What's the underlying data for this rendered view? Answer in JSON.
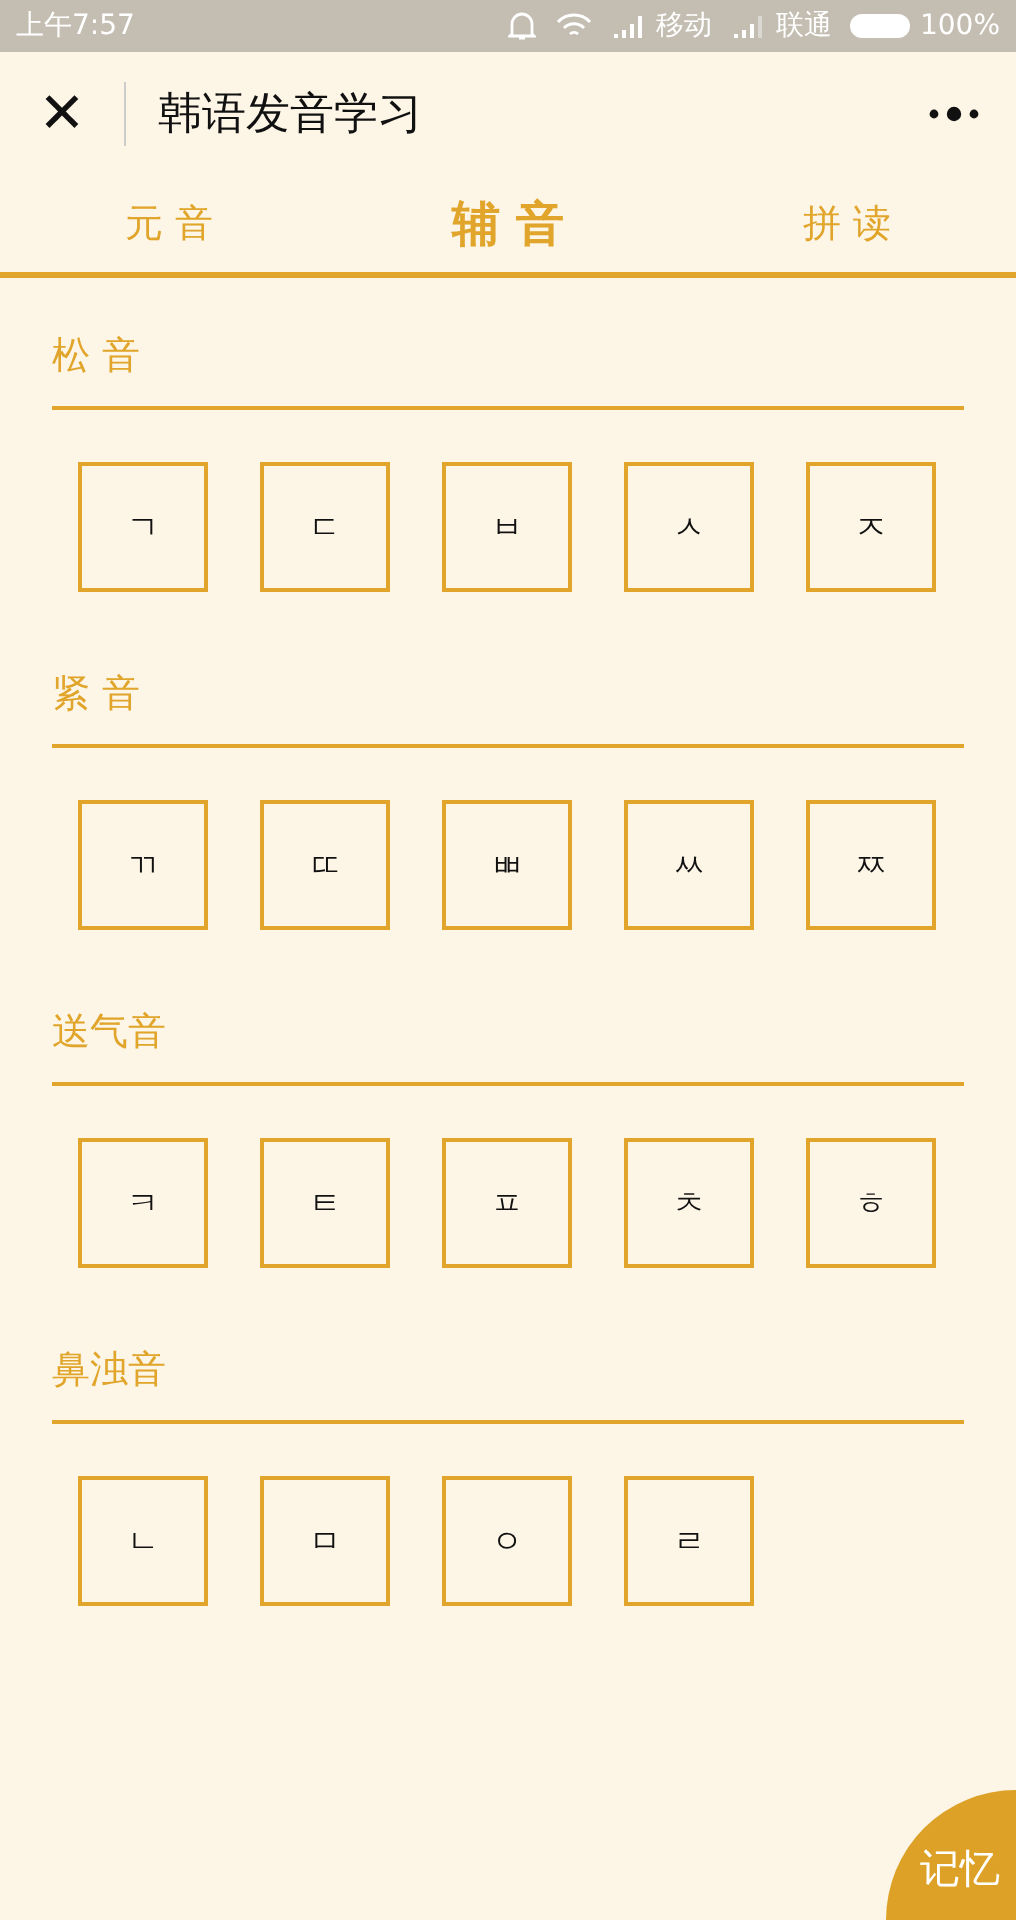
{
  "status_bar": {
    "time": "上午7:57",
    "carrier_1": "移动",
    "carrier_2": "联通",
    "battery": "100%"
  },
  "header": {
    "close": "✕",
    "title": "韩语发音学习"
  },
  "tabs": [
    {
      "label": "元 音",
      "selected": false
    },
    {
      "label": "辅 音",
      "selected": true
    },
    {
      "label": "拼 读",
      "selected": false
    }
  ],
  "sections": [
    {
      "title": "松 音",
      "letters": [
        "ㄱ",
        "ㄷ",
        "ㅂ",
        "ㅅ",
        "ㅈ"
      ]
    },
    {
      "title": "紧 音",
      "letters": [
        "ㄲ",
        "ㄸ",
        "ㅃ",
        "ㅆ",
        "ㅉ"
      ]
    },
    {
      "title": "送气音",
      "letters": [
        "ㅋ",
        "ㅌ",
        "ㅍ",
        "ㅊ",
        "ㅎ"
      ]
    },
    {
      "title": "鼻浊音",
      "letters": [
        "ㄴ",
        "ㅁ",
        "ㅇ",
        "ㄹ"
      ]
    }
  ],
  "memory_button": "记忆"
}
